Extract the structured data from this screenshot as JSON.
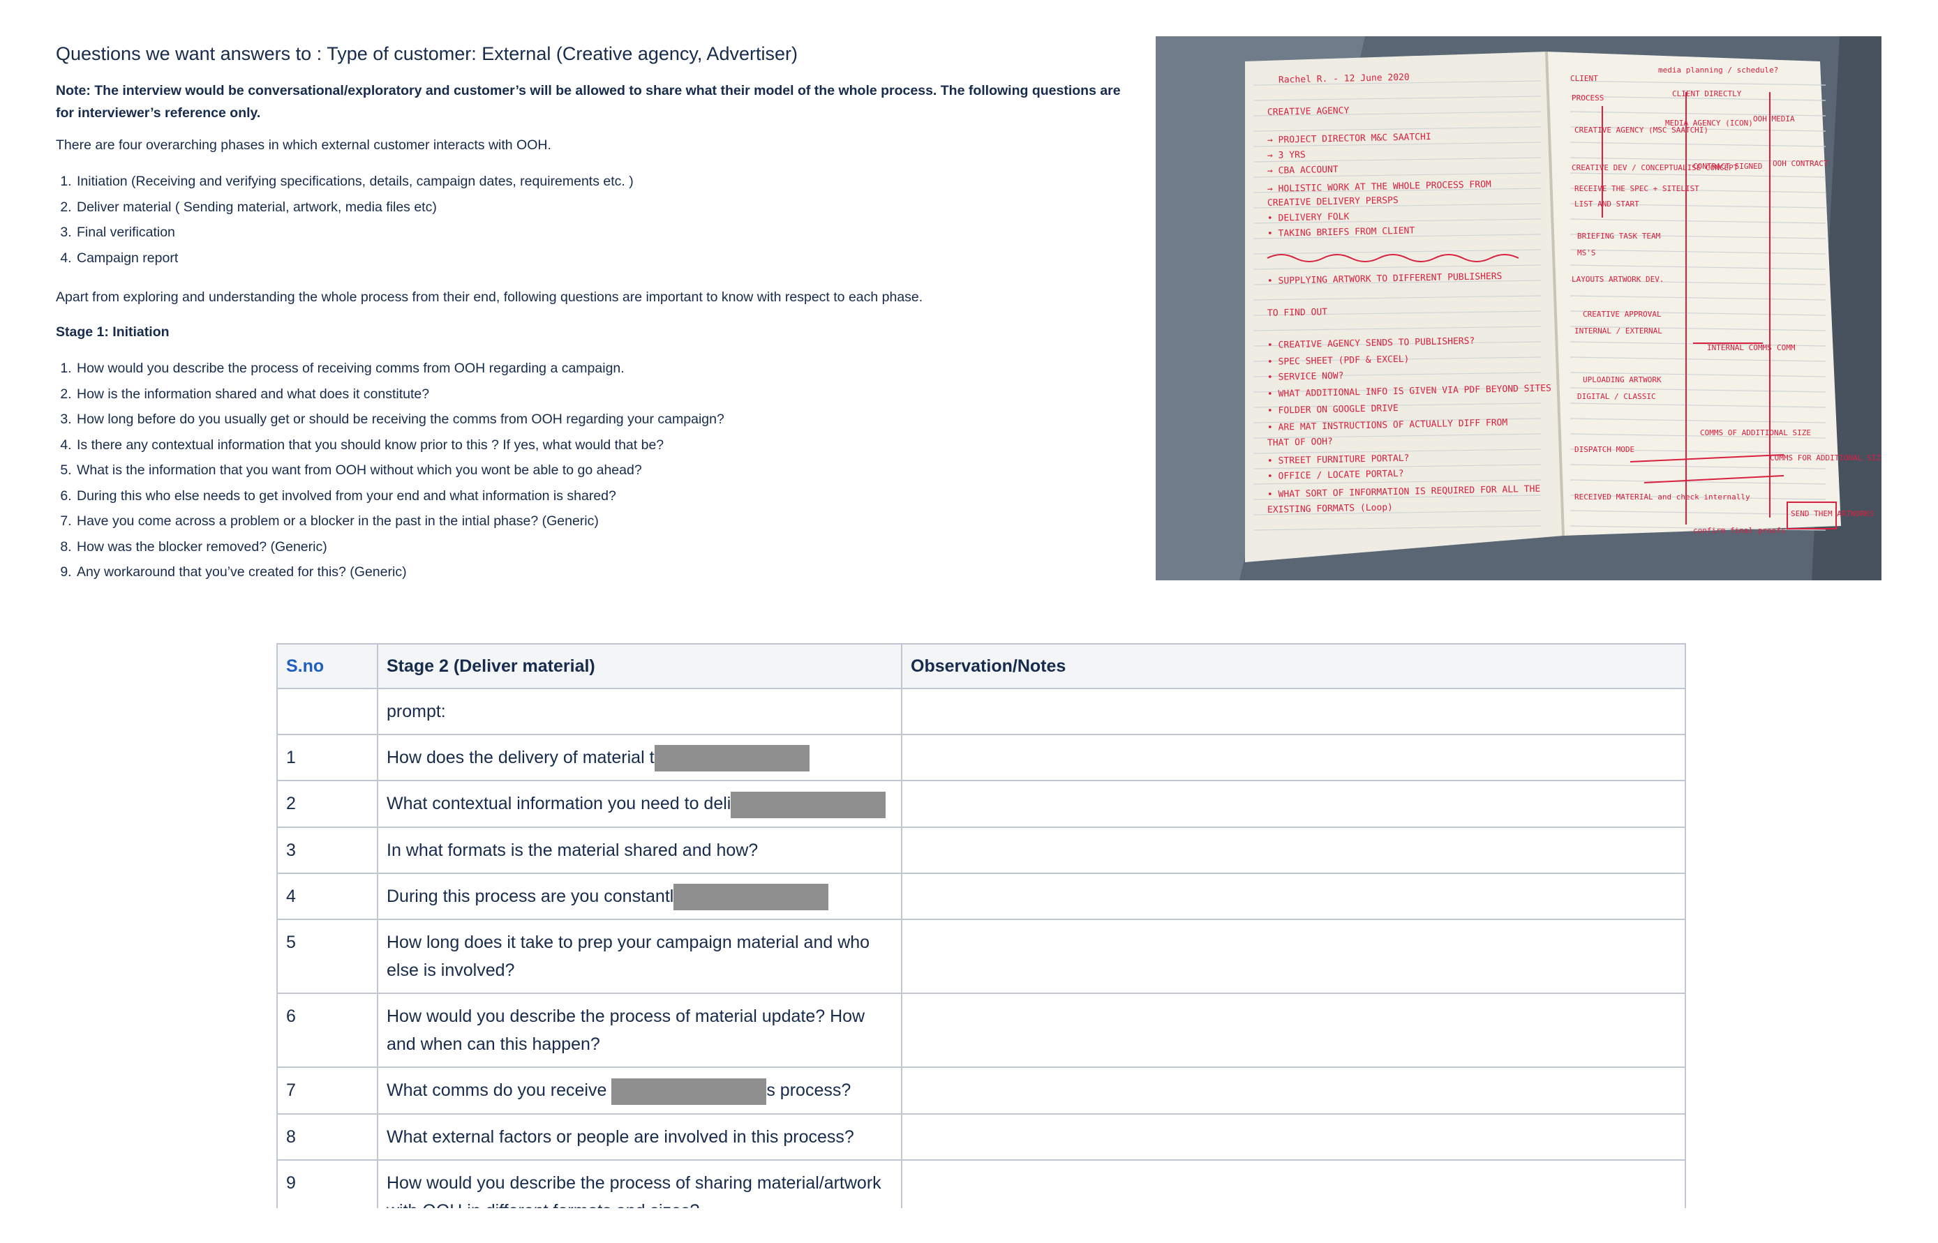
{
  "heading": "Questions we want answers to : Type of customer: External (Creative agency, Advertiser)",
  "note": "Note: The interview would be conversational/exploratory and customer’s will be allowed to share what their model of the whole process. The following questions are for interviewer’s reference only.",
  "phases_intro": "There are four overarching phases in which external customer interacts with OOH.",
  "phases": [
    "Initiation (Receiving and verifying specifications, details, campaign dates, requirements etc. )",
    "Deliver material ( Sending material, artwork, media files etc)",
    "Final verification",
    "Campaign report"
  ],
  "explore_text": "Apart from exploring and understanding the whole process from their end, following questions are important to know with respect to each phase.",
  "stage1_title": "Stage 1: Initiation",
  "stage1_questions": [
    "How would you describe the process of receiving comms from OOH regarding a campaign.",
    "How is the information shared and what does it constitute?",
    "How long before do you usually get or should be receiving the comms from OOH regarding your campaign?",
    "Is there any contextual information that you should know prior to this ? If yes, what would that be?",
    "What is the information that you want from OOH without which you wont be able to go ahead?",
    "During this who else needs to get involved  from your end and what information is shared?",
    "Have you come across a problem or a blocker in the past in the intial phase? (Generic)",
    "How was the blocker removed? (Generic)",
    "Any workaround that you’ve created for this? (Generic)"
  ],
  "notebook": {
    "left_page": [
      "Rachel R. - 12 June 2020",
      "CREATIVE AGENCY",
      "→ PROJECT DIRECTOR M&C SAATCHI",
      "→ 3 YRS",
      "→ CBA ACCOUNT",
      "→ HOLISTIC WORK AT THE WHOLE PROCESS FROM",
      "CREATIVE DELIVERY PERSPS",
      "• DELIVERY FOLK",
      "• TAKING BRIEFS FROM CLIENT",
      "• SUPPLYING ARTWORK TO DIFFERENT PUBLISHERS",
      "TO FIND OUT",
      "• CREATIVE AGENCY SENDS TO PUBLISHERS?",
      "• SPEC SHEET (PDF & EXCEL)",
      "• SERVICE NOW?",
      "• WHAT ADDITIONAL INFO IS GIVEN VIA PDF BEYOND SITES",
      "• FOLDER ON GOOGLE DRIVE",
      "• ARE MAT INSTRUCTIONS OF ACTUALLY DIFF FROM",
      "THAT OF OOH?",
      "• STREET FURNITURE PORTAL?",
      "• OFFICE / LOCATE PORTAL?",
      "• WHAT SORT OF INFORMATION IS REQUIRED FOR ALL THE",
      "EXISTING FORMATS (Loop)"
    ],
    "right_page": [
      "CLIENT",
      "media planning / schedule?",
      "PROCESS",
      "CLIENT DIRECTLY",
      "CREATIVE AGENCY (MSC SAATCHI)",
      "MEDIA AGENCY (ICON)",
      "OOH MEDIA",
      "CREATIVE DEV / CONCEPTUALISE CONCEPT",
      "CONTRACT SIGNED",
      "OOH CONTRACT",
      "RECEIVE THE SPEC + SITELIST",
      "LIST AND START",
      "BRIEFING TASK TEAM",
      "MS'S",
      "LAYOUTS ARTWORK DEV.",
      "CREATIVE APPROVAL",
      "INTERNAL / EXTERNAL",
      "INTERNAL COMMS",
      "COMM",
      "UPLOADING ARTWORK",
      "DIGITAL / CLASSIC",
      "COMMS OF ADDITIONAL SIZE",
      "DISPATCH MODE",
      "COMMS FOR ADDITIONAL SIZE",
      "RECEIVED MATERIAL and check internally",
      "SEND THEM ARTWORKS",
      "confirm final proofs"
    ]
  },
  "table": {
    "headers": [
      "S.no",
      "Stage 2 (Deliver material)",
      "Observation/Notes"
    ],
    "rows": [
      {
        "num": "",
        "text": "prompt:",
        "notes": ""
      },
      {
        "num": "1",
        "text": "How does the delivery of material t",
        "notes": ""
      },
      {
        "num": "2",
        "text": "What contextual information you need to deli",
        "notes": ""
      },
      {
        "num": "3",
        "text": "In what formats is the material shared and how?",
        "notes": ""
      },
      {
        "num": "4",
        "text": "During this process are you constantl",
        "notes": ""
      },
      {
        "num": "5",
        "text": "How long does it take to prep your campaign material and who else is involved?",
        "notes": ""
      },
      {
        "num": "6",
        "text": "How would you describe the process of material update? How and when can this happen?",
        "notes": ""
      },
      {
        "num": "7",
        "text": "What comms do you receive",
        "text_after": "s process?",
        "notes": ""
      },
      {
        "num": "8",
        "text": "What external factors or people are involved in this process?",
        "notes": ""
      },
      {
        "num": "9",
        "text": "How would you describe the process of sharing material/artwork with OOH in different formats and sizes?",
        "notes": ""
      }
    ]
  },
  "colors": {
    "text": "#172b4d",
    "sno_header": "#1f5fbf",
    "redaction": "#8f8f8f",
    "ink": "#d8203f",
    "border": "#c1c7d0"
  }
}
